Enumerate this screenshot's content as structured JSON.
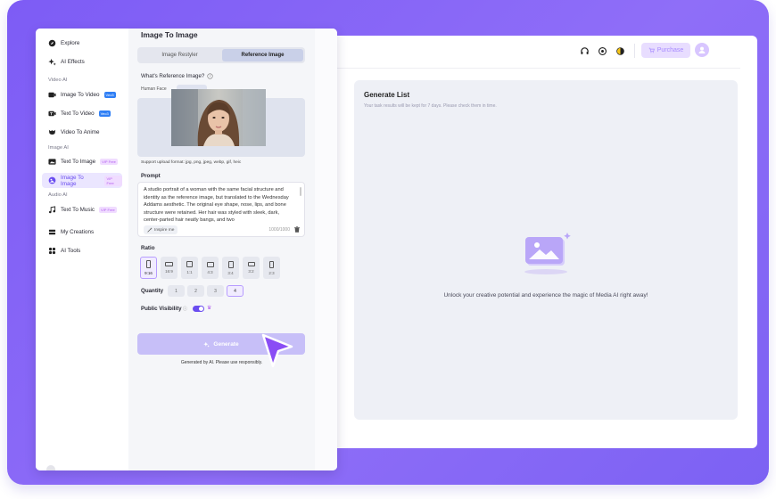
{
  "topbar": {
    "purchase_label": "Purchase"
  },
  "generate_list": {
    "title": "Generate List",
    "subtitle": "Your task results will be kept for 7 days. Please check them in time.",
    "empty_text": "Unlock your creative potential and experience the magic of Media AI right away!"
  },
  "sidebar": {
    "explore": "Explore",
    "ai_effects": "AI Effects",
    "section_video": "Video AI",
    "image_to_video": "Image To Video",
    "text_to_video": "Text To Video",
    "badge_new": "Veo3",
    "video_to_anime": "Video To Anime",
    "section_image": "Image AI",
    "text_to_image": "Text To Image",
    "image_to_image": "Image To Image",
    "badge_vip": "VIP Free",
    "section_audio": "Audio AI",
    "text_to_music": "Text To Music",
    "my_creations": "My Creations",
    "ai_tools": "AI Tools"
  },
  "panel": {
    "title": "Image To Image",
    "tabs": [
      "Image Restyler",
      "Reference Image"
    ],
    "active_tab": "Reference Image",
    "what_label": "What's Reference Image?",
    "human_face": "Human Face",
    "support": "Support upload format: jpg, png, jpeg, webp, gif, heic",
    "prompt_label": "Prompt",
    "prompt_text": "A studio portrait of a woman with the same facial structure and identity as the reference image, but translated to the Wednesday Addams aesthetic. The original eye shape, nose, lips, and bone structure were retained. Her hair was styled with sleek, dark, center-parted hair neatly bangs, and two",
    "inspire": "Inspire me",
    "counter": "1000/1000",
    "ratio_label": "Ratio",
    "ratios": [
      "9:16",
      "16:9",
      "1:1",
      "4:3",
      "3:4",
      "3:2",
      "2:3"
    ],
    "ratio_selected": "9:16",
    "quantity_label": "Quantity",
    "quantities": [
      "1",
      "2",
      "3",
      "4"
    ],
    "quantity_selected": "4",
    "visibility_label": "Public Visibility",
    "visibility_on": true,
    "generate_label": "Generate",
    "generate_note": "Generated by AI. Please use responsibly."
  },
  "colors": {
    "frame": "#7d5cf5",
    "accent": "#6a4df0",
    "generate_button": "#c7bff8",
    "badge_new": "#2f7ff5"
  }
}
